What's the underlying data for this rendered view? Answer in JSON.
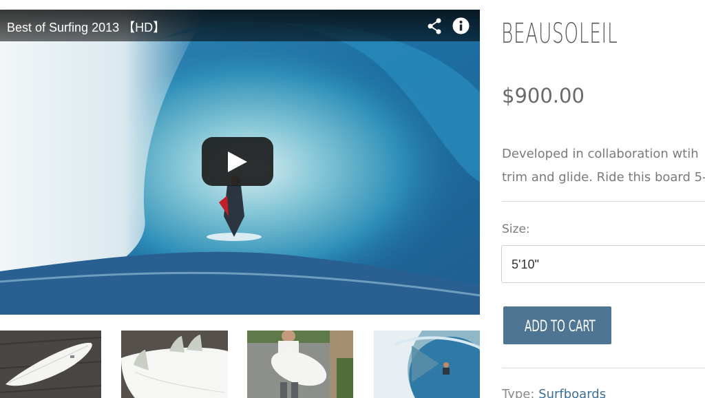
{
  "video": {
    "title": "Best of Surfing 2013 【HD】",
    "icons": [
      "share-icon",
      "info-icon",
      "play-icon"
    ]
  },
  "thumbnails": [
    {
      "name": "white surfboard on deck"
    },
    {
      "name": "surfboard fins on deck"
    },
    {
      "name": "person holding surfboard"
    },
    {
      "name": "surfing video"
    }
  ],
  "product": {
    "title": "BEAUSOLEIL",
    "price": "$900.00",
    "description_line1": "Developed in collaboration wtih",
    "description_line2": "trim and glide. Ride this board 5-",
    "size_label": "Size:",
    "size_value": "5'10\"",
    "add_to_cart_label": "ADD TO CART",
    "type_label": "Type:",
    "type_value": "Surfboards"
  },
  "colors": {
    "button": "#4e7693",
    "link": "#3d6f96",
    "text": "#7a7a7a"
  }
}
